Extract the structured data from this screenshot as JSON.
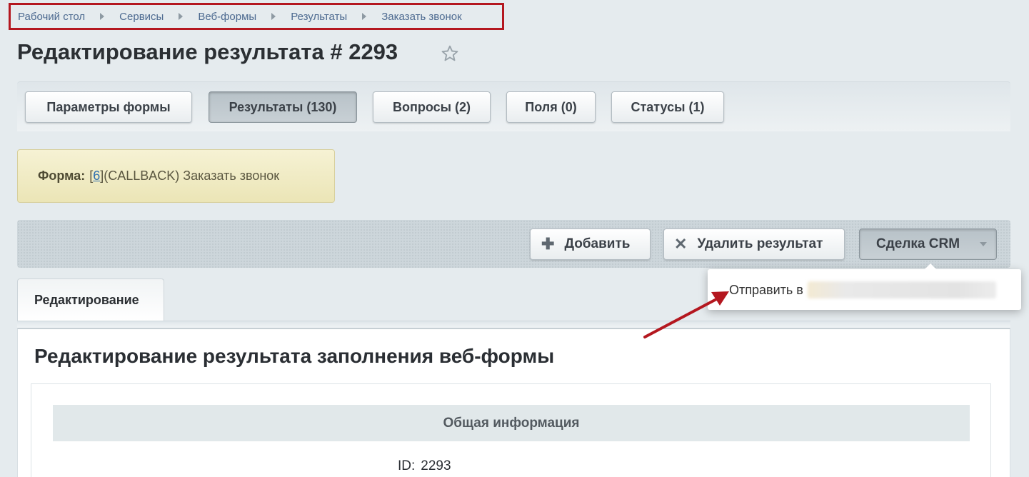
{
  "breadcrumb": [
    "Рабочий стол",
    "Сервисы",
    "Веб-формы",
    "Результаты",
    "Заказать звонок"
  ],
  "page": {
    "title": "Редактирование результата # 2293"
  },
  "tabs": [
    {
      "label": "Параметры формы"
    },
    {
      "label": "Результаты (130)"
    },
    {
      "label": "Вопросы (2)"
    },
    {
      "label": "Поля (0)"
    },
    {
      "label": "Статусы (1)"
    }
  ],
  "form_info": {
    "label": "Форма:",
    "bracket_open": "[",
    "id": "6",
    "bracket_close": "]",
    "rest": " (CALLBACK) Заказать звонок"
  },
  "toolbar": {
    "add_label": "Добавить",
    "delete_label": "Удалить результат",
    "crm_label": "Сделка CRM"
  },
  "crm_menu": {
    "item_label": "Отправить в"
  },
  "edit_tab": {
    "label": "Редактирование"
  },
  "panel": {
    "heading": "Редактирование результата заполнения веб-формы",
    "section_title": "Общая информация",
    "id_label": "ID:",
    "id_value": "2293"
  },
  "colors": {
    "breadcrumb_highlight": "#b4171f",
    "annotation_arrow": "#b4171f",
    "link": "#4d6a90"
  }
}
